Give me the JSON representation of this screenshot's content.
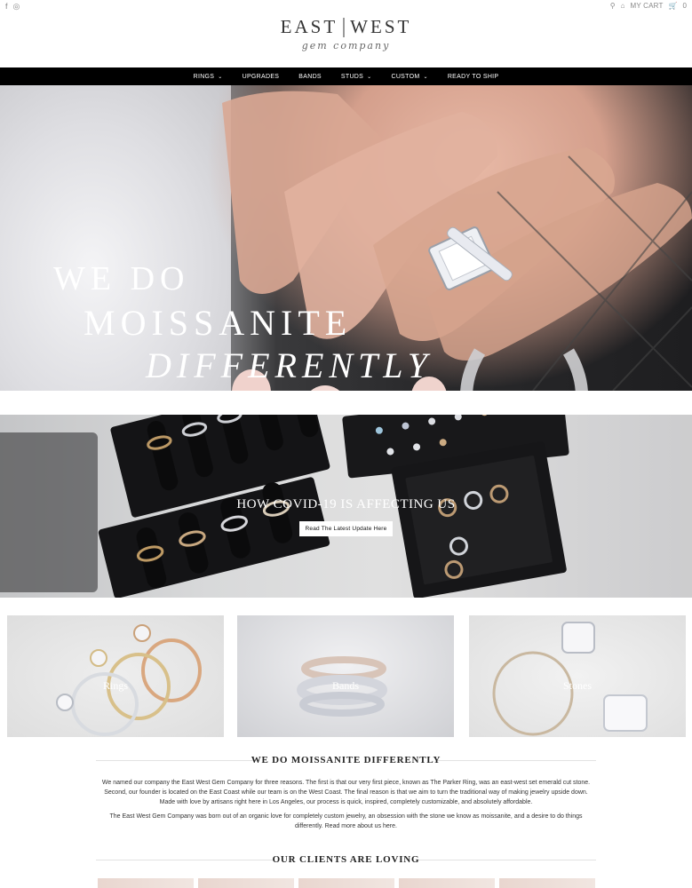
{
  "topbar": {
    "social_icons": [
      "facebook-icon",
      "instagram-icon"
    ],
    "social_glyphs": [
      "f",
      "◎"
    ],
    "search_glyph": "⚲",
    "account_glyph": "⌂",
    "cart_label": "MY CART",
    "cart_glyph": "🛒",
    "cart_count": "0"
  },
  "logo": {
    "left": "EAST",
    "right": "WEST",
    "sub": "gem company"
  },
  "nav": {
    "items": [
      {
        "label": "RINGS",
        "dropdown": true
      },
      {
        "label": "UPGRADES",
        "dropdown": false
      },
      {
        "label": "BANDS",
        "dropdown": false
      },
      {
        "label": "STUDS",
        "dropdown": true
      },
      {
        "label": "CUSTOM",
        "dropdown": true
      },
      {
        "label": "READY TO SHIP",
        "dropdown": false
      }
    ],
    "chevron": "⌄"
  },
  "hero": {
    "line1": "WE DO",
    "line2": "MOISSANITE",
    "line3": "DIFFERENTLY"
  },
  "covid": {
    "title": "HOW COVID-19 IS AFFECTING US",
    "button": "Read The Latest Update Here"
  },
  "tiles": [
    {
      "label": "Rings"
    },
    {
      "label": "Bands"
    },
    {
      "label": "Stones"
    }
  ],
  "about": {
    "title": "WE DO MOISSANITE DIFFERENTLY",
    "p1": "We named our company the East West Gem Company for three reasons. The first is that our very first piece, known as The Parker Ring, was an east-west set emerald cut stone. Second, our founder is located on the East Coast while our team is on the West Coast. The final reason is that we aim to turn the traditional way of making jewelry upside down. Made with love by artisans right here in Los Angeles, our process is quick, inspired, completely customizable, and absolutely affordable.",
    "p2": "The East West Gem Company was born out of an organic love for completely custom jewelry, an obsession with the stone we know as moissanite, and a desire to do things differently. Read more about us here."
  },
  "clients": {
    "title": "OUR CLIENTS ARE LOVING"
  },
  "colors": {
    "nav_bg": "#000000",
    "text": "#222222",
    "white": "#ffffff"
  }
}
